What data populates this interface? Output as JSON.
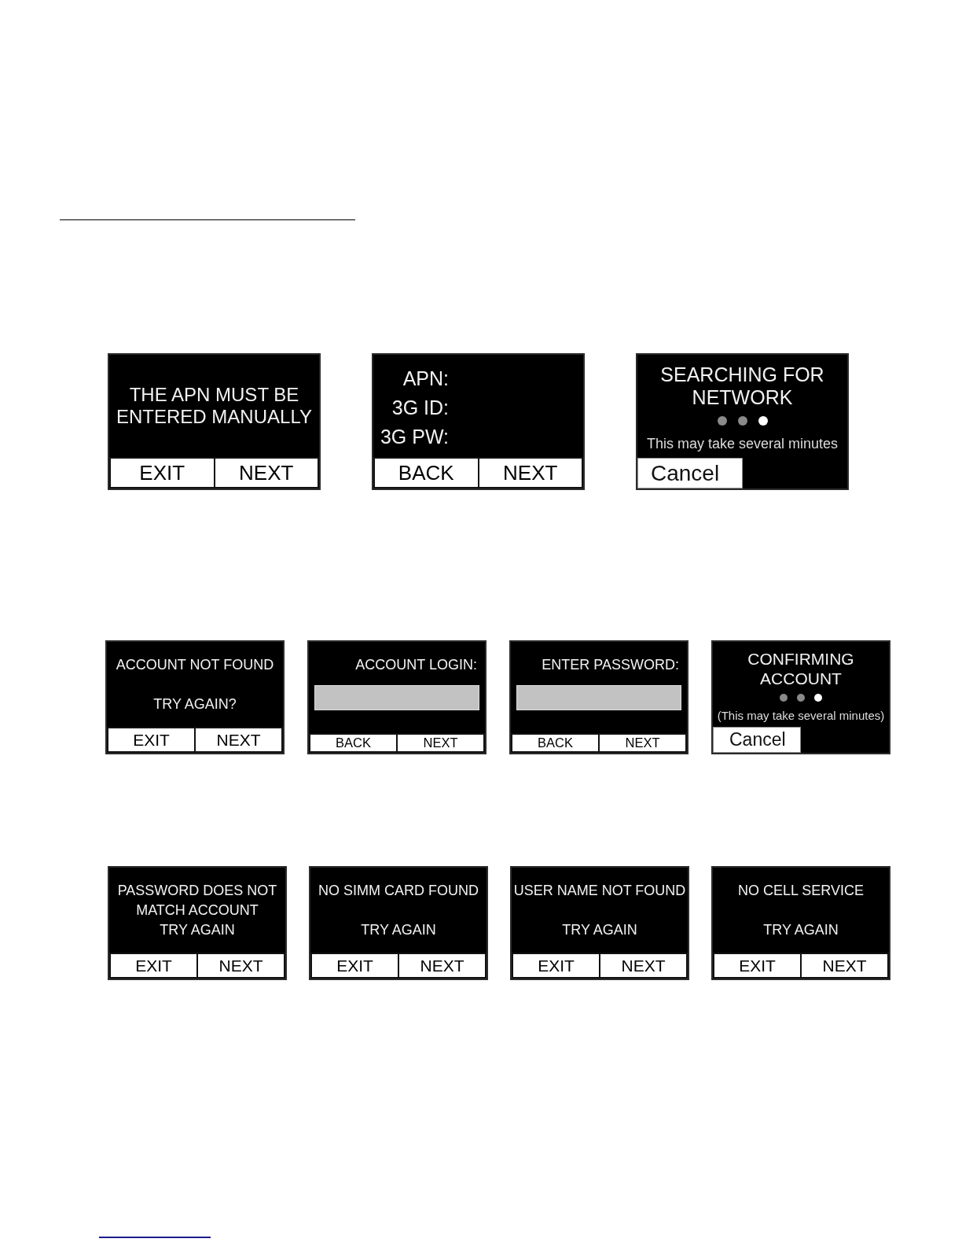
{
  "rows": [
    {
      "screens": [
        {
          "kind": "message",
          "message": [
            "THE APN MUST BE",
            "ENTERED MANUALLY"
          ],
          "buttons": [
            "EXIT",
            "NEXT"
          ]
        },
        {
          "kind": "labels",
          "labels": [
            "APN:",
            "3G ID:",
            "3G PW:"
          ],
          "buttons": [
            "BACK",
            "NEXT"
          ]
        },
        {
          "kind": "progress",
          "title": [
            "SEARCHING FOR",
            "NETWORK"
          ],
          "dots": [
            {
              "active": false
            },
            {
              "active": false
            },
            {
              "active": true
            }
          ],
          "note": "This may take several minutes",
          "cancel": "Cancel"
        }
      ]
    },
    {
      "screens": [
        {
          "kind": "message",
          "message": [
            "ACCOUNT NOT FOUND"
          ],
          "prompt": "TRY AGAIN?",
          "buttons": [
            "EXIT",
            "NEXT"
          ]
        },
        {
          "kind": "field",
          "label": "ACCOUNT LOGIN:",
          "buttons": [
            "BACK",
            "NEXT"
          ]
        },
        {
          "kind": "field",
          "label": "ENTER PASSWORD:",
          "buttons": [
            "BACK",
            "NEXT"
          ]
        },
        {
          "kind": "progress",
          "title": [
            "CONFIRMING",
            "ACCOUNT"
          ],
          "dots": [
            {
              "active": false
            },
            {
              "active": false
            },
            {
              "active": true
            }
          ],
          "note": "(This may take several minutes)",
          "cancel": "Cancel"
        }
      ]
    },
    {
      "screens": [
        {
          "kind": "message",
          "message": [
            "PASSWORD DOES NOT",
            "MATCH ACCOUNT"
          ],
          "prompt": "TRY AGAIN",
          "buttons": [
            "EXIT",
            "NEXT"
          ]
        },
        {
          "kind": "message",
          "message": [
            "NO SIMM CARD FOUND"
          ],
          "prompt": "TRY AGAIN",
          "buttons": [
            "EXIT",
            "NEXT"
          ]
        },
        {
          "kind": "message",
          "message": [
            "USER NAME NOT FOUND"
          ],
          "prompt": "TRY AGAIN",
          "buttons": [
            "EXIT",
            "NEXT"
          ]
        },
        {
          "kind": "message",
          "message": [
            "NO CELL SERVICE"
          ],
          "prompt": "TRY AGAIN",
          "buttons": [
            "EXIT",
            "NEXT"
          ]
        }
      ]
    }
  ]
}
